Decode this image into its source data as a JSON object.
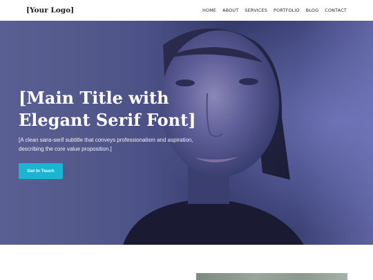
{
  "header": {
    "logo": "[Your Logo]",
    "nav": [
      "HOME",
      "ABOUT",
      "SERVICES",
      "PORTFOLIO",
      "BLOG",
      "CONTACT"
    ]
  },
  "hero": {
    "title": "[Main Title with Elegant Serif Font]",
    "subtitle": "[A clean sans-serif subtitle that conveys professionalism and aspiration, describing the core value proposition.]",
    "cta_label": "Get In Touch",
    "overlay_color": "#4a4f86",
    "cta_color": "#1bb4d2"
  }
}
